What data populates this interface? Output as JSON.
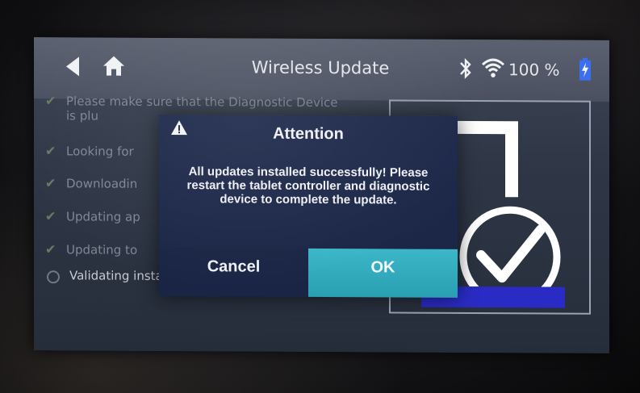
{
  "header": {
    "title": "Wireless Update",
    "battery_level": "100 %",
    "icons": [
      "back-arrow-icon",
      "home-icon",
      "bluetooth-icon",
      "wifi-icon",
      "battery-charging-icon"
    ]
  },
  "steps": [
    {
      "status": "done",
      "label": "Please make sure that the Diagnostic Device is plu"
    },
    {
      "status": "done",
      "label": "Looking for"
    },
    {
      "status": "done",
      "label": "Downloadin"
    },
    {
      "status": "done",
      "label": "Updating ap"
    },
    {
      "status": "done",
      "label": "Updating to"
    },
    {
      "status": "in-progress",
      "label": "Validating installed components..."
    }
  ],
  "dialog": {
    "title": "Attention",
    "message": "All updates installed successfully! Please restart the tablet controller and diagnostic device to complete the update.",
    "cancel_label": "Cancel",
    "ok_label": "OK"
  },
  "colors": {
    "dialog_bg": "#1f2a4c",
    "ok_button": "#3bb7c8",
    "progress": "#2122a8",
    "battery": "#3b6ff0"
  }
}
